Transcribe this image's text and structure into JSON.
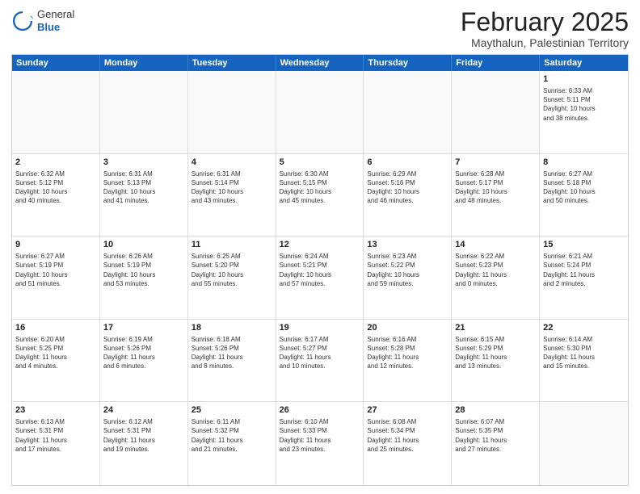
{
  "logo": {
    "general": "General",
    "blue": "Blue"
  },
  "title": "February 2025",
  "subtitle": "Maythalun, Palestinian Territory",
  "days": [
    "Sunday",
    "Monday",
    "Tuesday",
    "Wednesday",
    "Thursday",
    "Friday",
    "Saturday"
  ],
  "weeks": [
    [
      {
        "day": "",
        "content": ""
      },
      {
        "day": "",
        "content": ""
      },
      {
        "day": "",
        "content": ""
      },
      {
        "day": "",
        "content": ""
      },
      {
        "day": "",
        "content": ""
      },
      {
        "day": "",
        "content": ""
      },
      {
        "day": "1",
        "content": "Sunrise: 6:33 AM\nSunset: 5:11 PM\nDaylight: 10 hours\nand 38 minutes."
      }
    ],
    [
      {
        "day": "2",
        "content": "Sunrise: 6:32 AM\nSunset: 5:12 PM\nDaylight: 10 hours\nand 40 minutes."
      },
      {
        "day": "3",
        "content": "Sunrise: 6:31 AM\nSunset: 5:13 PM\nDaylight: 10 hours\nand 41 minutes."
      },
      {
        "day": "4",
        "content": "Sunrise: 6:31 AM\nSunset: 5:14 PM\nDaylight: 10 hours\nand 43 minutes."
      },
      {
        "day": "5",
        "content": "Sunrise: 6:30 AM\nSunset: 5:15 PM\nDaylight: 10 hours\nand 45 minutes."
      },
      {
        "day": "6",
        "content": "Sunrise: 6:29 AM\nSunset: 5:16 PM\nDaylight: 10 hours\nand 46 minutes."
      },
      {
        "day": "7",
        "content": "Sunrise: 6:28 AM\nSunset: 5:17 PM\nDaylight: 10 hours\nand 48 minutes."
      },
      {
        "day": "8",
        "content": "Sunrise: 6:27 AM\nSunset: 5:18 PM\nDaylight: 10 hours\nand 50 minutes."
      }
    ],
    [
      {
        "day": "9",
        "content": "Sunrise: 6:27 AM\nSunset: 5:19 PM\nDaylight: 10 hours\nand 51 minutes."
      },
      {
        "day": "10",
        "content": "Sunrise: 6:26 AM\nSunset: 5:19 PM\nDaylight: 10 hours\nand 53 minutes."
      },
      {
        "day": "11",
        "content": "Sunrise: 6:25 AM\nSunset: 5:20 PM\nDaylight: 10 hours\nand 55 minutes."
      },
      {
        "day": "12",
        "content": "Sunrise: 6:24 AM\nSunset: 5:21 PM\nDaylight: 10 hours\nand 57 minutes."
      },
      {
        "day": "13",
        "content": "Sunrise: 6:23 AM\nSunset: 5:22 PM\nDaylight: 10 hours\nand 59 minutes."
      },
      {
        "day": "14",
        "content": "Sunrise: 6:22 AM\nSunset: 5:23 PM\nDaylight: 11 hours\nand 0 minutes."
      },
      {
        "day": "15",
        "content": "Sunrise: 6:21 AM\nSunset: 5:24 PM\nDaylight: 11 hours\nand 2 minutes."
      }
    ],
    [
      {
        "day": "16",
        "content": "Sunrise: 6:20 AM\nSunset: 5:25 PM\nDaylight: 11 hours\nand 4 minutes."
      },
      {
        "day": "17",
        "content": "Sunrise: 6:19 AM\nSunset: 5:26 PM\nDaylight: 11 hours\nand 6 minutes."
      },
      {
        "day": "18",
        "content": "Sunrise: 6:18 AM\nSunset: 5:26 PM\nDaylight: 11 hours\nand 8 minutes."
      },
      {
        "day": "19",
        "content": "Sunrise: 6:17 AM\nSunset: 5:27 PM\nDaylight: 11 hours\nand 10 minutes."
      },
      {
        "day": "20",
        "content": "Sunrise: 6:16 AM\nSunset: 5:28 PM\nDaylight: 11 hours\nand 12 minutes."
      },
      {
        "day": "21",
        "content": "Sunrise: 6:15 AM\nSunset: 5:29 PM\nDaylight: 11 hours\nand 13 minutes."
      },
      {
        "day": "22",
        "content": "Sunrise: 6:14 AM\nSunset: 5:30 PM\nDaylight: 11 hours\nand 15 minutes."
      }
    ],
    [
      {
        "day": "23",
        "content": "Sunrise: 6:13 AM\nSunset: 5:31 PM\nDaylight: 11 hours\nand 17 minutes."
      },
      {
        "day": "24",
        "content": "Sunrise: 6:12 AM\nSunset: 5:31 PM\nDaylight: 11 hours\nand 19 minutes."
      },
      {
        "day": "25",
        "content": "Sunrise: 6:11 AM\nSunset: 5:32 PM\nDaylight: 11 hours\nand 21 minutes."
      },
      {
        "day": "26",
        "content": "Sunrise: 6:10 AM\nSunset: 5:33 PM\nDaylight: 11 hours\nand 23 minutes."
      },
      {
        "day": "27",
        "content": "Sunrise: 6:08 AM\nSunset: 5:34 PM\nDaylight: 11 hours\nand 25 minutes."
      },
      {
        "day": "28",
        "content": "Sunrise: 6:07 AM\nSunset: 5:35 PM\nDaylight: 11 hours\nand 27 minutes."
      },
      {
        "day": "",
        "content": ""
      }
    ]
  ]
}
